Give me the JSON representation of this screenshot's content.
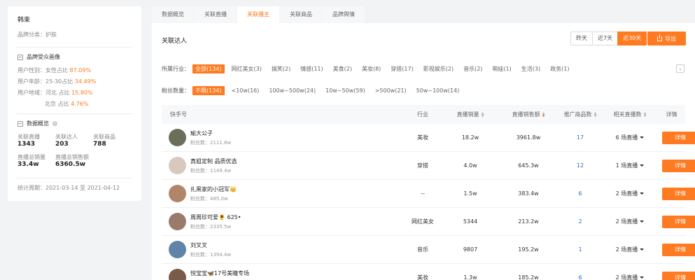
{
  "left": {
    "brand": "韩束",
    "category_label": "品牌分类：",
    "category_value": "护肤",
    "audience_title": "品牌受众画像",
    "gender_label": "用户性别：",
    "gender_text": "女性占比",
    "gender_value": "87.09%",
    "age_label": "用户年龄：",
    "age_text": "25-30占比",
    "age_value": "34.49%",
    "region_label": "用户地域：",
    "region1_text": "河北 占比",
    "region1_value": "15.80%",
    "region2_text": "北京 占比",
    "region2_value": "4.76%",
    "overview_title": "数据概览",
    "info_icon": "i",
    "stats": [
      {
        "label": "关联直播",
        "value": "1343"
      },
      {
        "label": "关联达人",
        "value": "203"
      },
      {
        "label": "关联商品",
        "value": "788"
      },
      {
        "label": "直播总销量",
        "value": "33.4w"
      },
      {
        "label": "直播总销售额",
        "value": "6360.5w"
      }
    ],
    "period_label": "统计周期：",
    "period_value": "2021-03-14 至 2021-04-12"
  },
  "tabs": [
    "数据概览",
    "关联直播",
    "关联播主",
    "关联商品",
    "品牌舆情"
  ],
  "active_tab": 2,
  "header": {
    "title": "关联达人",
    "ranges": [
      "昨天",
      "近7天",
      "近30天"
    ],
    "active_range": 2,
    "export_label": "导出"
  },
  "filters": {
    "industry_label": "所属行业：",
    "industry": [
      "全部(134)",
      "网红美女(3)",
      "搞笑(2)",
      "情感(11)",
      "美食(2)",
      "美妆(8)",
      "穿搭(17)",
      "影视娱乐(2)",
      "音乐(2)",
      "萌娃(1)",
      "生活(3)",
      "政务(1)"
    ],
    "fans_label": "粉丝数量：",
    "fans": [
      "不限(134)",
      "<10w(16)",
      "100w~500w(24)",
      "10w~50w(59)",
      ">500w(21)",
      "50w~100w(14)"
    ],
    "expand_icon": "chevron-down-icon"
  },
  "table": {
    "headers": [
      "快手号",
      "行业",
      "直播销量",
      "直播销售额",
      "推广商品数",
      "相关直播数",
      "详情"
    ],
    "detail_label": "详情",
    "rows": [
      {
        "name": "瑜大公子",
        "fans": "粉丝数：2111.8w",
        "industry": "美妆",
        "sales": "18.2w",
        "revenue": "3961.8w",
        "products": "17",
        "lives": "6 场直播",
        "avatar_color": "#6b6f5a"
      },
      {
        "name": "真姐定制 品质优选",
        "fans": "粉丝数：1149.4w",
        "industry": "穿搭",
        "sales": "4.0w",
        "revenue": "645.3w",
        "products": "12",
        "lives": "1 场直播",
        "avatar_color": "#d9c8bd"
      },
      {
        "name": "扎黑家的小冠军👑",
        "fans": "粉丝数：485.0w",
        "industry": "--",
        "sales": "1.5w",
        "revenue": "383.4w",
        "products": "6",
        "lives": "2 场直播",
        "avatar_color": "#b08668"
      },
      {
        "name": "周周珍可爱🌻 625•",
        "fans": "粉丝数：2335.5w",
        "industry": "网红美女",
        "sales": "5344",
        "revenue": "213.2w",
        "products": "2",
        "lives": "2 场直播",
        "avatar_color": "#9a7a6c"
      },
      {
        "name": "刘叉叉",
        "fans": "粉丝数：1394.4w",
        "industry": "音乐",
        "sales": "9807",
        "revenue": "195.2w",
        "products": "1",
        "lives": "2 场直播",
        "avatar_color": "#5f84a8"
      },
      {
        "name": "悦宝宝🦋17号美瞳专场",
        "fans": "粉丝数：",
        "industry": "美妆",
        "sales": "1.3w",
        "revenue": "185.2w",
        "products": "6",
        "lives": "2 场直播",
        "avatar_color": "#7a5a4a"
      }
    ]
  }
}
